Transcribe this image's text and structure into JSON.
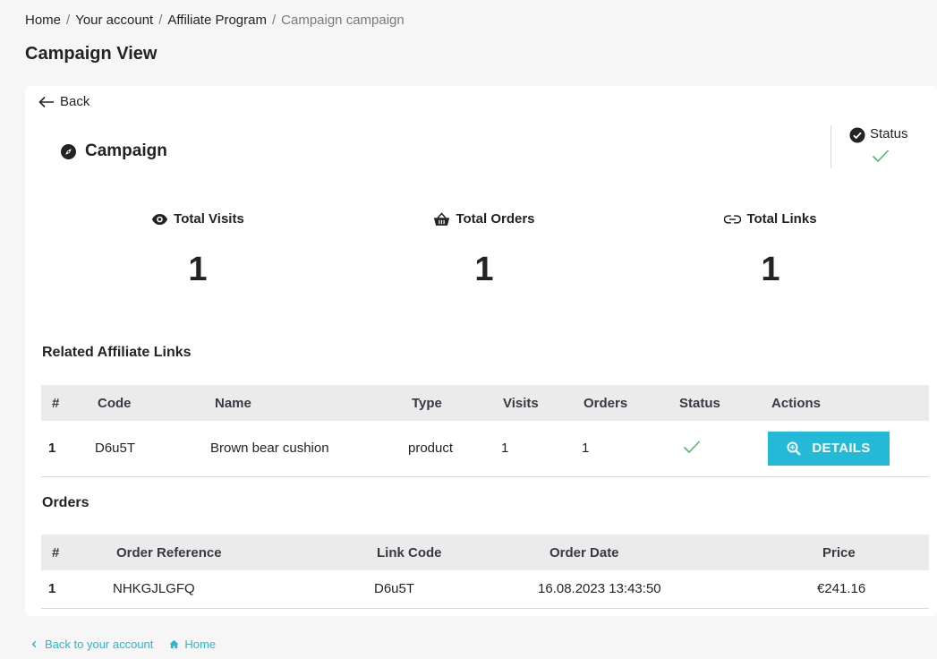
{
  "breadcrumb": {
    "items": [
      "Home",
      "Your account",
      "Affiliate Program"
    ],
    "separator": "/",
    "current": "Campaign campaign"
  },
  "page_title": "Campaign View",
  "back_label": "Back",
  "campaign_label": "Campaign",
  "status": {
    "label": "Status",
    "active": true,
    "icon": "check-mark-icon"
  },
  "stats": [
    {
      "label": "Total Visits",
      "value": "1",
      "icon": "eye-icon"
    },
    {
      "label": "Total Orders",
      "value": "1",
      "icon": "basket-icon"
    },
    {
      "label": "Total Links",
      "value": "1",
      "icon": "link-icon"
    }
  ],
  "links_section": {
    "title": "Related Affiliate Links",
    "headers": [
      "#",
      "Code",
      "Name",
      "Type",
      "Visits",
      "Orders",
      "Status",
      "Actions"
    ],
    "rows": [
      {
        "num": "1",
        "code": "D6u5T",
        "name": "Brown bear cushion",
        "type": "product",
        "visits": "1",
        "orders": "1",
        "status_active": true,
        "action_label": "DETAILS"
      }
    ]
  },
  "orders_section": {
    "title": "Orders",
    "headers": [
      "#",
      "Order Reference",
      "Link Code",
      "Order Date",
      "Price"
    ],
    "rows": [
      {
        "num": "1",
        "reference": "NHKGJLGFQ",
        "link_code": "D6u5T",
        "date": "16.08.2023 13:43:50",
        "price": "€241.16"
      }
    ]
  },
  "footer": {
    "back_account": "Back to your account",
    "home": "Home"
  },
  "colors": {
    "accent": "#24b9d7",
    "success": "#4cbb6c",
    "text": "#232323",
    "header_bg": "#ebebeb"
  }
}
